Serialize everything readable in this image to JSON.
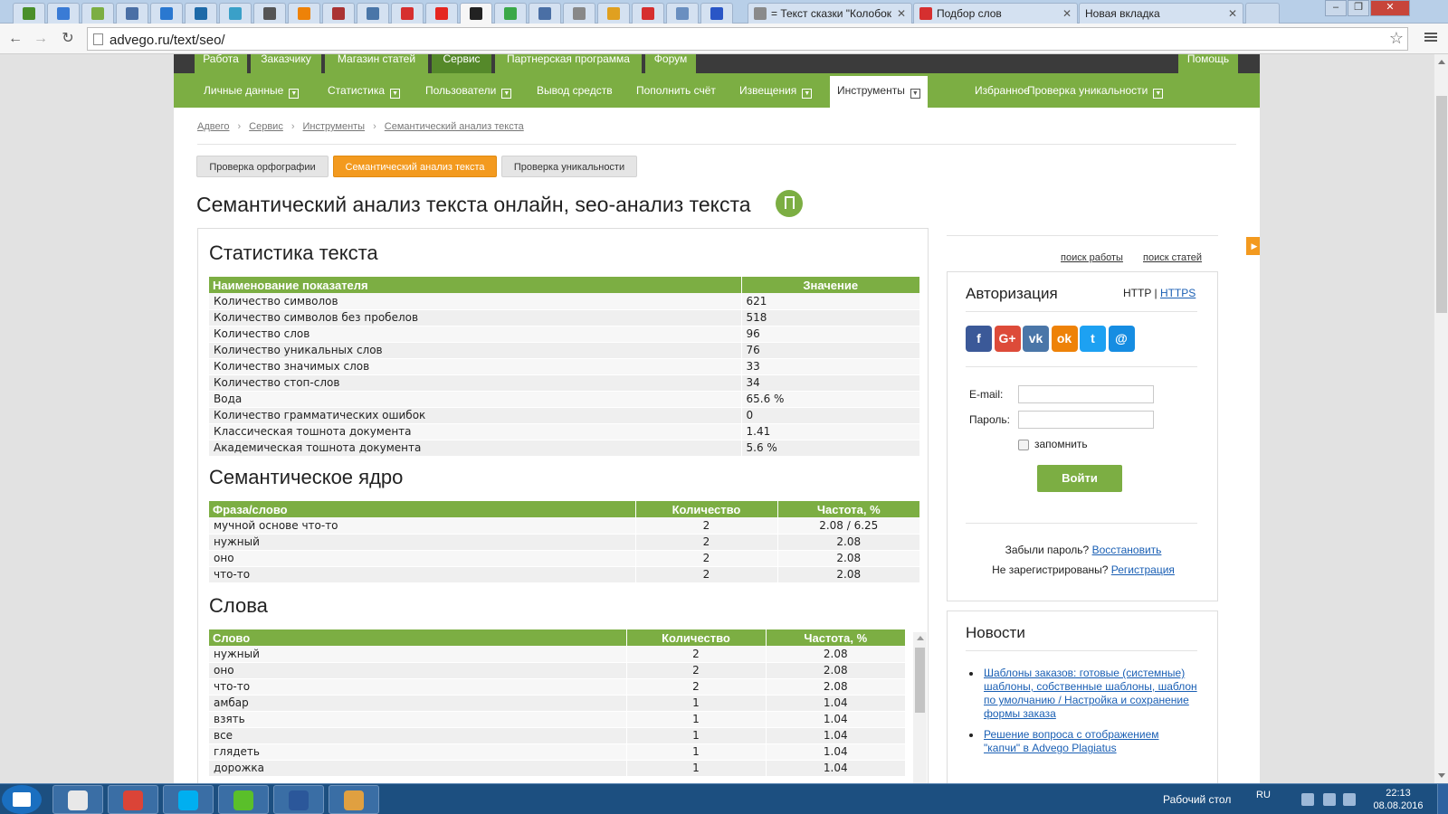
{
  "browser": {
    "tabs": [
      {
        "icon": "advego-icon",
        "color": "#4a8f2a"
      },
      {
        "icon": "mail-icon",
        "color": "#3a7bd5"
      },
      {
        "icon": "leaf-icon",
        "color": "#7cae43"
      },
      {
        "icon": "grid-icon",
        "color": "#4a6fa5"
      },
      {
        "icon": "globe-icon",
        "color": "#2a78d0"
      },
      {
        "icon": "linkedin-icon",
        "color": "#1e6aa8"
      },
      {
        "icon": "target-icon",
        "color": "#3aa0c8"
      },
      {
        "icon": "glasses-icon",
        "color": "#555555"
      },
      {
        "icon": "odnoklassniki-icon",
        "color": "#ee8208"
      },
      {
        "icon": "bug-icon",
        "color": "#aa3333"
      },
      {
        "icon": "vk-icon",
        "color": "#4a76a8"
      },
      {
        "icon": "star-badge-icon",
        "color": "#d62f2f"
      },
      {
        "icon": "yandex-icon",
        "color": "#e52620"
      },
      {
        "icon": "advego-a-icon",
        "color": "#222222"
      },
      {
        "icon": "counter-icon",
        "color": "#3aa848"
      },
      {
        "icon": "pen-icon",
        "color": "#4a6fa5"
      },
      {
        "icon": "doc-icon",
        "color": "#888888"
      },
      {
        "icon": "m-icon",
        "color": "#e0a020"
      },
      {
        "icon": "copyright-icon",
        "color": "#d62f2f"
      },
      {
        "icon": "box-icon",
        "color": "#6a8fc0"
      },
      {
        "icon": "flag-ru-icon",
        "color": "#2a56c6"
      }
    ],
    "wide_tabs": [
      {
        "title": "= Текст сказки \"Колобок",
        "icon": "page-icon",
        "color": "#8a8a8a"
      },
      {
        "title": "Подбор слов",
        "icon": "stats-icon",
        "color": "#d62f2f"
      },
      {
        "title": "Новая вкладка",
        "icon": "",
        "color": ""
      }
    ],
    "url": "advego.ru/text/seo/"
  },
  "site": {
    "top_nav": [
      "Работа",
      "Заказчику",
      "Магазин статей",
      "Сервис",
      "Партнерская программа",
      "Форум",
      "Помощь"
    ],
    "sub_nav": [
      {
        "label": "Личные данные",
        "dropdown": true
      },
      {
        "label": "Статистика",
        "dropdown": true
      },
      {
        "label": "Пользователи",
        "dropdown": true
      },
      {
        "label": "Вывод средств",
        "dropdown": false
      },
      {
        "label": "Пополнить счёт",
        "dropdown": false
      },
      {
        "label": "Извещения",
        "dropdown": true
      },
      {
        "label": "Инструменты",
        "dropdown": true
      },
      {
        "label": "Избранное",
        "dropdown": false
      },
      {
        "label": "Проверка уникальности",
        "dropdown": true
      }
    ],
    "breadcrumb": [
      "Адвего",
      "Сервис",
      "Инструменты",
      "Семантический анализ текста"
    ],
    "tools": [
      "Проверка орфографии",
      "Семантический анализ текста",
      "Проверка уникальности"
    ],
    "title": "Семантический анализ текста онлайн, seo-анализ текста"
  },
  "stats": {
    "heading": "Статистика текста",
    "columns": [
      "Наименование показателя",
      "Значение"
    ],
    "rows": [
      [
        "Количество символов",
        "621"
      ],
      [
        "Количество символов без пробелов",
        "518"
      ],
      [
        "Количество слов",
        "96"
      ],
      [
        "Количество уникальных слов",
        "76"
      ],
      [
        "Количество значимых слов",
        "33"
      ],
      [
        "Количество стоп-слов",
        "34"
      ],
      [
        "Вода",
        "65.6 %"
      ],
      [
        "Количество грамматических ошибок",
        "0"
      ],
      [
        "Классическая тошнота документа",
        "1.41"
      ],
      [
        "Академическая тошнота документа",
        "5.6 %"
      ]
    ]
  },
  "core": {
    "heading": "Семантическое ядро",
    "columns": [
      "Фраза/слово",
      "Количество",
      "Частота, %"
    ],
    "rows": [
      [
        "мучной основе что-то",
        "2",
        "2.08 / 6.25"
      ],
      [
        "нужный",
        "2",
        "2.08"
      ],
      [
        "оно",
        "2",
        "2.08"
      ],
      [
        "что-то",
        "2",
        "2.08"
      ]
    ]
  },
  "words": {
    "heading": "Слова",
    "columns": [
      "Слово",
      "Количество",
      "Частота, %"
    ],
    "rows": [
      [
        "нужный",
        "2",
        "2.08"
      ],
      [
        "оно",
        "2",
        "2.08"
      ],
      [
        "что-то",
        "2",
        "2.08"
      ],
      [
        "амбар",
        "1",
        "1.04"
      ],
      [
        "взять",
        "1",
        "1.04"
      ],
      [
        "все",
        "1",
        "1.04"
      ],
      [
        "глядеть",
        "1",
        "1.04"
      ],
      [
        "дорожка",
        "1",
        "1.04"
      ]
    ]
  },
  "sidebar": {
    "search_jobs": "поиск работы",
    "search_articles": "поиск статей",
    "auth": {
      "title": "Авторизация",
      "http": "HTTP",
      "sep": "|",
      "https": "HTTPS",
      "socials": [
        {
          "icon": "facebook-icon",
          "glyph": "f",
          "color": "#3b5998"
        },
        {
          "icon": "google-plus-icon",
          "glyph": "G+",
          "color": "#dd4b39"
        },
        {
          "icon": "vk-icon",
          "glyph": "vk",
          "color": "#4a76a8"
        },
        {
          "icon": "odnoklassniki-icon",
          "glyph": "ok",
          "color": "#ee8208"
        },
        {
          "icon": "twitter-icon",
          "glyph": "t",
          "color": "#1da1f2"
        },
        {
          "icon": "mail-ru-icon",
          "glyph": "@",
          "color": "#168de2"
        }
      ],
      "email_label": "E-mail:",
      "password_label": "Пароль:",
      "remember": "запомнить",
      "login": "Войти",
      "forgot_text": "Забыли пароль?",
      "forgot_link": "Восстановить",
      "noreg_text": "Не зарегистрированы?",
      "noreg_link": "Регистрация"
    },
    "news": {
      "title": "Новости",
      "items": [
        "Шаблоны заказов: готовые (системные) шаблоны, собственные шаблоны, шаблон по умолчанию / Настройка и сохранение формы заказа",
        "Решение вопроса с отображением \"капчи\" в Advego Plagiatus"
      ]
    }
  },
  "taskbar": {
    "apps": [
      {
        "icon": "file-icon",
        "color": "#e8e8e8"
      },
      {
        "icon": "chrome-icon",
        "color": "#db4437"
      },
      {
        "icon": "skype-icon",
        "color": "#00aff0"
      },
      {
        "icon": "icq-icon",
        "color": "#5abf2a"
      },
      {
        "icon": "word-icon",
        "color": "#2b579a"
      },
      {
        "icon": "paint-icon",
        "color": "#e0a040"
      }
    ],
    "desktop": "Рабочий стол",
    "lang": "RU",
    "time": "22:13",
    "date": "08.08.2016"
  }
}
